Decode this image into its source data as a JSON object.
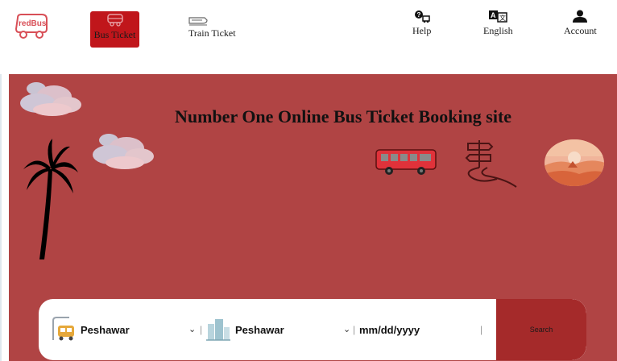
{
  "header": {
    "logo_text": "redBus",
    "tabs": [
      {
        "label": "Bus Ticket",
        "icon": "bus-icon",
        "active": true
      },
      {
        "label": "Train Ticket",
        "icon": "train-icon",
        "active": false
      }
    ],
    "actions": [
      {
        "label": "Help",
        "icon": "help-icon"
      },
      {
        "label": "English",
        "icon": "language-icon"
      },
      {
        "label": "Account",
        "icon": "account-icon"
      }
    ]
  },
  "hero": {
    "title": "Number One Online Bus Ticket Booking site",
    "background_color": "#b04444",
    "illustrations": [
      "cloud",
      "cloud",
      "palm-tree",
      "bus",
      "signpost",
      "desert-sunset"
    ]
  },
  "search": {
    "source": {
      "value": "Peshawar",
      "icon": "bus-stop-icon"
    },
    "destination": {
      "value": "Peshawar",
      "icon": "city-icon"
    },
    "date": {
      "value": "mm/dd/yyyy",
      "icon": "calendar-icon"
    },
    "button_label": "Search",
    "button_color": "#a52a2a"
  },
  "colors": {
    "brand": "#c0161b",
    "hero": "#b04444"
  }
}
